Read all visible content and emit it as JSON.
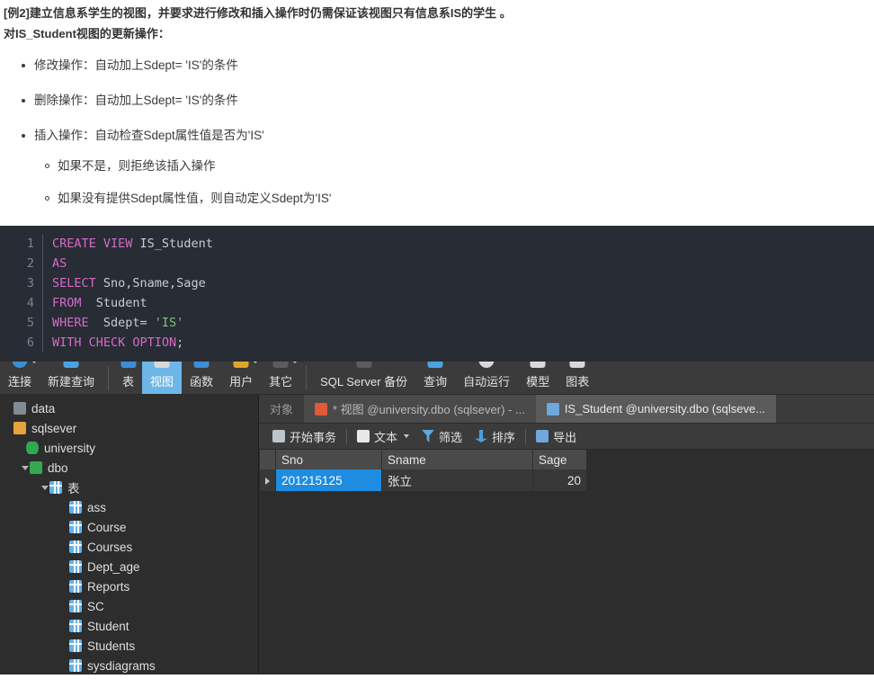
{
  "article": {
    "heading_line1": "[例2]建立信息系学生的视图，并要求进行修改和插入操作时仍需保证该视图只有信息系IS的学生 。",
    "heading_line2": "对IS_Student视图的更新操作：",
    "bullets": [
      {
        "text": "修改操作：自动加上Sdept= 'IS'的条件"
      },
      {
        "text": "删除操作：自动加上Sdept= 'IS'的条件"
      },
      {
        "text": "插入操作：自动检查Sdept属性值是否为'IS'",
        "sub": [
          "如果不是，则拒绝该插入操作",
          "如果没有提供Sdept属性值，则自动定义Sdept为'IS'"
        ]
      }
    ]
  },
  "code": {
    "language": "sql",
    "lines": [
      {
        "n": "1",
        "parts": [
          {
            "t": "CREATE VIEW ",
            "c": "kw"
          },
          {
            "t": "IS_Student",
            "c": ""
          }
        ]
      },
      {
        "n": "2",
        "parts": [
          {
            "t": "AS",
            "c": "kw"
          }
        ]
      },
      {
        "n": "3",
        "parts": [
          {
            "t": "SELECT ",
            "c": "kw"
          },
          {
            "t": "Sno,Sname,Sage",
            "c": ""
          }
        ]
      },
      {
        "n": "4",
        "parts": [
          {
            "t": "FROM",
            "c": "kw"
          },
          {
            "t": "  Student",
            "c": ""
          }
        ]
      },
      {
        "n": "5",
        "parts": [
          {
            "t": "WHERE",
            "c": "kw"
          },
          {
            "t": "  Sdept= ",
            "c": ""
          },
          {
            "t": "'IS'",
            "c": "str"
          }
        ]
      },
      {
        "n": "6",
        "parts": [
          {
            "t": "WITH CHECK OPTION",
            "c": "kw"
          },
          {
            "t": ";",
            "c": ""
          }
        ]
      }
    ]
  },
  "app": {
    "toolbar": {
      "items": [
        {
          "label": "连接",
          "icon": "connect-icon",
          "icon_class": "blue round",
          "caret": true
        },
        {
          "label": "新建查询",
          "icon": "new-query-icon",
          "icon_class": "grid",
          "caret": false
        },
        {
          "label": "表",
          "icon": "table-icon",
          "icon_class": "blue",
          "caret": false
        },
        {
          "label": "视图",
          "icon": "view-icon",
          "icon_class": "white",
          "caret": false,
          "active": true
        },
        {
          "label": "函数",
          "icon": "function-icon",
          "icon_class": "blue",
          "caret": false
        },
        {
          "label": "用户",
          "icon": "user-icon",
          "icon_class": "gold",
          "caret": true
        },
        {
          "label": "其它",
          "icon": "other-icon",
          "icon_class": "dark",
          "caret": true
        },
        {
          "label": "SQL Server 备份",
          "icon": "backup-icon",
          "icon_class": "dark",
          "caret": false
        },
        {
          "label": "查询",
          "icon": "query-icon",
          "icon_class": "grid",
          "caret": false
        },
        {
          "label": "自动运行",
          "icon": "automation-icon",
          "icon_class": "white round",
          "caret": false
        },
        {
          "label": "模型",
          "icon": "model-icon",
          "icon_class": "white",
          "caret": false
        },
        {
          "label": "图表",
          "icon": "chart-icon",
          "icon_class": "white",
          "caret": false
        }
      ]
    },
    "sidebar": {
      "items": [
        {
          "label": "data",
          "icon": "server-icon",
          "icon_class": "server",
          "indent": 0,
          "arrow": false
        },
        {
          "label": "sqlsever",
          "icon": "connection-icon",
          "icon_class": "conn",
          "indent": 0,
          "arrow": false
        },
        {
          "label": "university",
          "icon": "database-icon",
          "icon_class": "db",
          "indent": 14,
          "arrow": false
        },
        {
          "label": "dbo",
          "icon": "schema-icon",
          "icon_class": "schema",
          "indent": 18,
          "arrow": true
        },
        {
          "label": "表",
          "icon": "tables-folder-icon",
          "icon_class": "tablefolder",
          "indent": 40,
          "arrow": true
        },
        {
          "label": "ass",
          "icon": "table-icon",
          "icon_class": "table",
          "indent": 62,
          "arrow": false
        },
        {
          "label": "Course",
          "icon": "table-icon",
          "icon_class": "table",
          "indent": 62,
          "arrow": false
        },
        {
          "label": "Courses",
          "icon": "table-icon",
          "icon_class": "table",
          "indent": 62,
          "arrow": false
        },
        {
          "label": "Dept_age",
          "icon": "table-icon",
          "icon_class": "table",
          "indent": 62,
          "arrow": false
        },
        {
          "label": "Reports",
          "icon": "table-icon",
          "icon_class": "table",
          "indent": 62,
          "arrow": false
        },
        {
          "label": "SC",
          "icon": "table-icon",
          "icon_class": "table",
          "indent": 62,
          "arrow": false
        },
        {
          "label": "Student",
          "icon": "table-icon",
          "icon_class": "table",
          "indent": 62,
          "arrow": false
        },
        {
          "label": "Students",
          "icon": "table-icon",
          "icon_class": "table",
          "indent": 62,
          "arrow": false
        },
        {
          "label": "sysdiagrams",
          "icon": "table-icon",
          "icon_class": "table",
          "indent": 62,
          "arrow": false
        }
      ]
    },
    "tabs": [
      {
        "label": "对象",
        "state": "plain",
        "icon": "",
        "icon_class": ""
      },
      {
        "label": "* 视图 @university.dbo (sqlsever) - ...",
        "state": "inactive",
        "icon": "view-designer-icon",
        "icon_class": "view1"
      },
      {
        "label": "IS_Student @university.dbo (sqlseve...",
        "state": "active",
        "icon": "view-data-icon",
        "icon_class": "view2"
      }
    ],
    "grid_toolbar": [
      {
        "label": "开始事务",
        "icon": "begin-transaction-icon",
        "icon_class": "trans",
        "caret": false,
        "sep_after": true
      },
      {
        "label": "文本",
        "icon": "text-icon",
        "icon_class": "text",
        "caret": true,
        "sep_after": false
      },
      {
        "label": "筛选",
        "icon": "filter-icon",
        "icon_class": "filter",
        "caret": false,
        "sep_after": false
      },
      {
        "label": "排序",
        "icon": "sort-icon",
        "icon_class": "sort",
        "caret": false,
        "sep_after": true
      },
      {
        "label": "导出",
        "icon": "export-icon",
        "icon_class": "export",
        "caret": false,
        "sep_after": false
      }
    ],
    "result_grid": {
      "columns": [
        {
          "label": "Sno",
          "width": 118
        },
        {
          "label": "Sname",
          "width": 168
        },
        {
          "label": "Sage",
          "width": 60
        }
      ],
      "rows": [
        {
          "selected_col": 0,
          "cells": [
            "201215125",
            "张立",
            "20"
          ]
        }
      ]
    }
  },
  "colors": {
    "accent": "#6cb6e8",
    "selection": "#1e8ce0",
    "toolbar_bg": "#3b3b3b",
    "panel_bg": "#2d2d2d",
    "code_bg": "#282c34",
    "keyword": "#d56ac8",
    "string": "#7fc27f"
  }
}
